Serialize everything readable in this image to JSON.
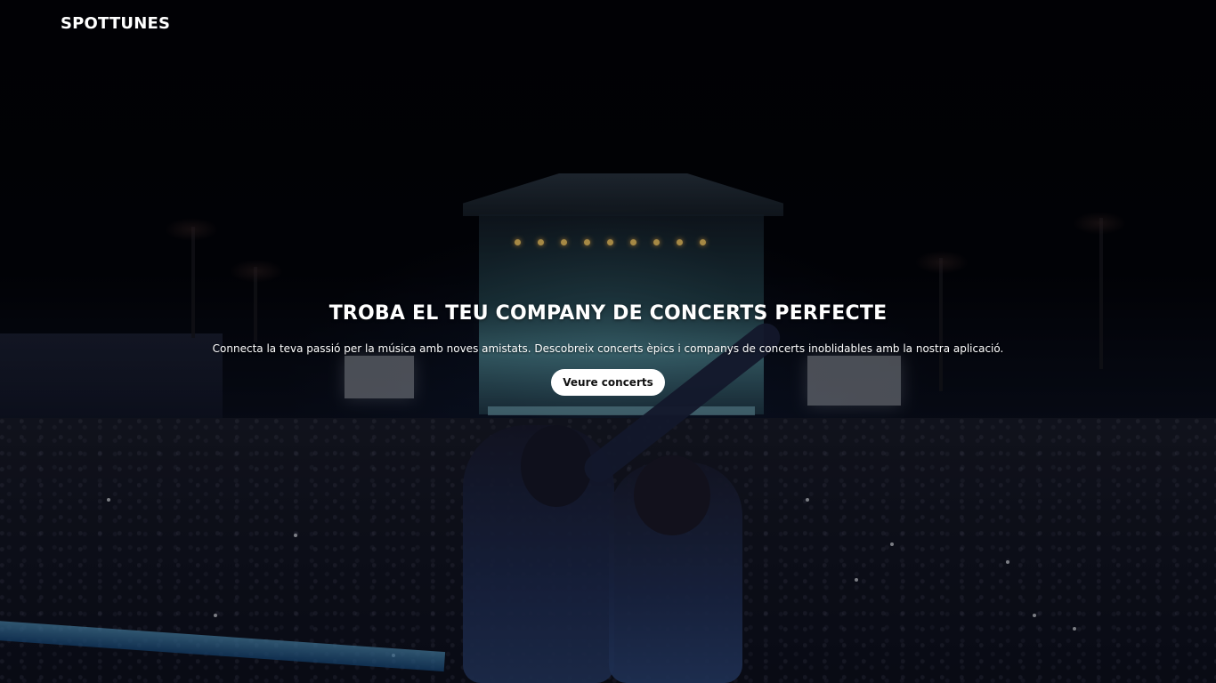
{
  "header": {
    "brand": "SPOTTUNES"
  },
  "hero": {
    "title": "TROBA EL TEU COMPANY DE CONCERTS PERFECTE",
    "subtitle": "Connecta la teva passió per la música amb noves amistats. Descobreix concerts èpics i companys de concerts inoblidables amb la nostra aplicació.",
    "cta_label": "Veure concerts",
    "background_image": "concert-crowd-at-night"
  },
  "colors": {
    "text": "#ffffff",
    "button_bg": "#ffffff",
    "button_text": "#111111",
    "background": "#05060b"
  }
}
